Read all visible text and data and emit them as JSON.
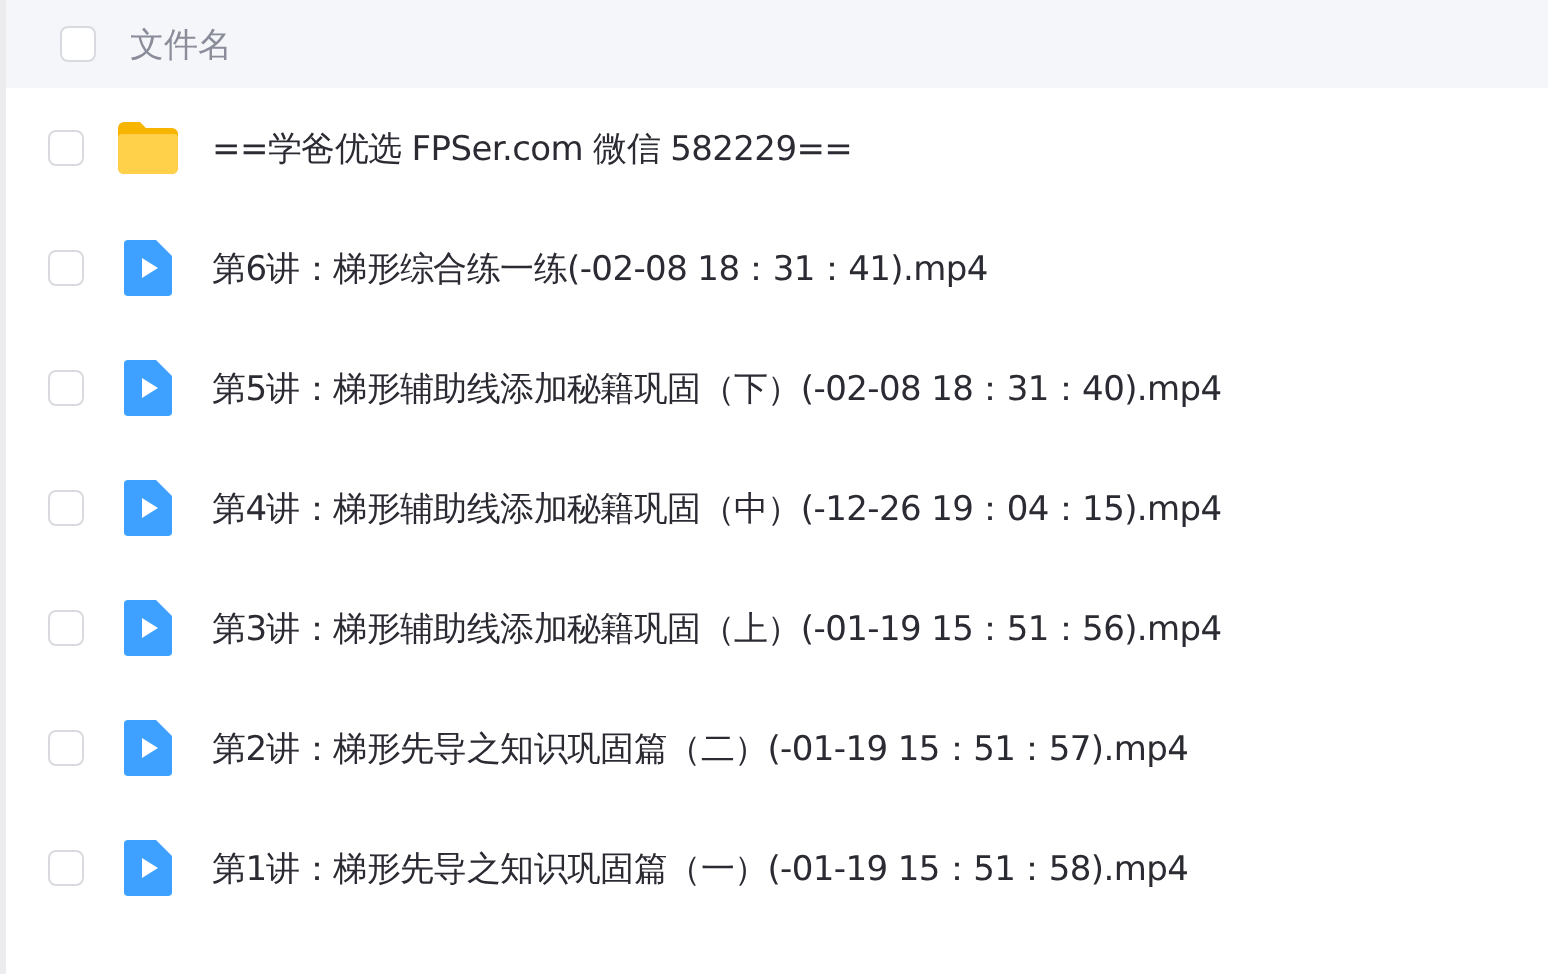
{
  "header": {
    "label": "文件名",
    "checked": false
  },
  "files": [
    {
      "kind": "folder",
      "name": "==学爸优选 FPSer.com 微信 582229==",
      "checked": false
    },
    {
      "kind": "video",
      "name": "第6讲：梯形综合练一练(-02-08 18：31：41).mp4",
      "checked": false
    },
    {
      "kind": "video",
      "name": "第5讲：梯形辅助线添加秘籍巩固（下）(-02-08 18：31：40).mp4",
      "checked": false
    },
    {
      "kind": "video",
      "name": "第4讲：梯形辅助线添加秘籍巩固（中）(-12-26 19：04：15).mp4",
      "checked": false
    },
    {
      "kind": "video",
      "name": "第3讲：梯形辅助线添加秘籍巩固（上）(-01-19 15：51：56).mp4",
      "checked": false
    },
    {
      "kind": "video",
      "name": "第2讲：梯形先导之知识巩固篇（二）(-01-19 15：51：57).mp4",
      "checked": false
    },
    {
      "kind": "video",
      "name": "第1讲：梯形先导之知识巩固篇（一）(-01-19 15：51：58).mp4",
      "checked": false
    }
  ]
}
